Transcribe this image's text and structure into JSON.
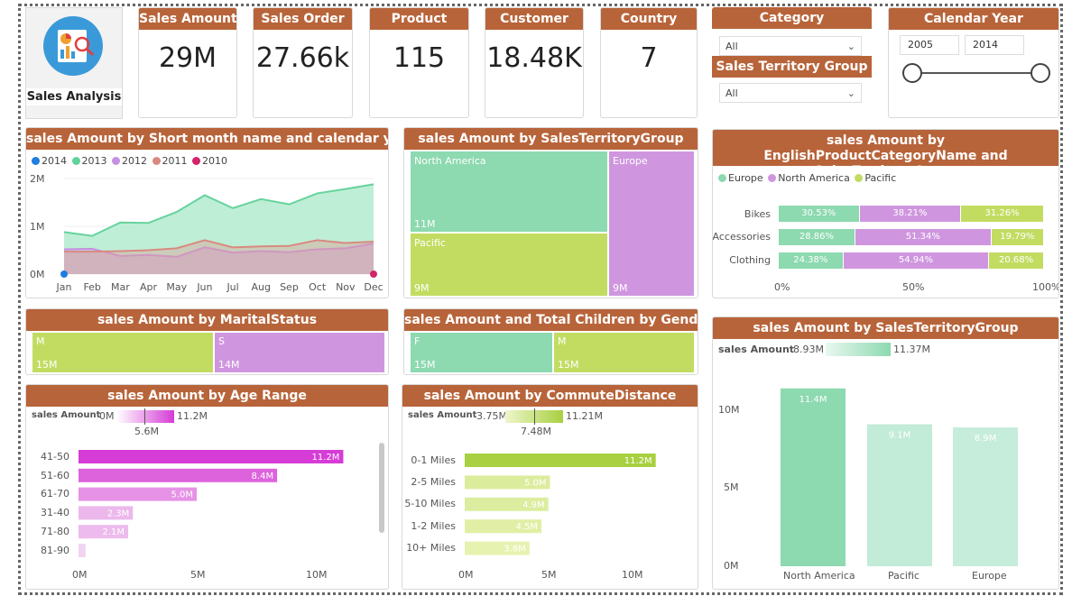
{
  "logo": {
    "title": "Sales Analysis"
  },
  "kpis": [
    {
      "title": "Sales Amount",
      "value": "29M"
    },
    {
      "title": "Sales Order",
      "value": "27.66k"
    },
    {
      "title": "Product",
      "value": "115"
    },
    {
      "title": "Customer",
      "value": "18.48K"
    },
    {
      "title": "Country",
      "value": "7"
    }
  ],
  "filters": {
    "category": {
      "title": "Category",
      "value": "All"
    },
    "territory": {
      "title": "Sales Territory Group",
      "value": "All"
    },
    "calendar": {
      "title": "Calendar Year",
      "from": "2005",
      "to": "2014"
    }
  },
  "colors": {
    "header": "#b8643a",
    "green": "#8dd9b0",
    "purple": "#cf96df",
    "lime": "#c2dc62",
    "magenta": "#d63cd6"
  },
  "chart_data": [
    {
      "type": "area",
      "title": "sales Amount by Short month name and calendar year",
      "legend": [
        "2014",
        "2013",
        "2012",
        "2011",
        "2010"
      ],
      "legend_colors": [
        "#1f7de0",
        "#5fd39a",
        "#c690e0",
        "#d98a80",
        "#d2266a"
      ],
      "x": [
        "Jan",
        "Feb",
        "Mar",
        "Apr",
        "May",
        "Jun",
        "Jul",
        "Aug",
        "Sep",
        "Oct",
        "Nov",
        "Dec"
      ],
      "yticks": [
        "2M",
        "1M",
        "0M"
      ],
      "ylim": [
        0,
        2000000
      ],
      "series": [
        {
          "name": "2013",
          "values": [
            880000,
            800000,
            1080000,
            1070000,
            1300000,
            1650000,
            1380000,
            1570000,
            1460000,
            1690000,
            1780000,
            1880000
          ]
        },
        {
          "name": "2012",
          "values": [
            520000,
            530000,
            380000,
            400000,
            360000,
            560000,
            450000,
            480000,
            460000,
            520000,
            540000,
            640000
          ]
        },
        {
          "name": "2011",
          "values": [
            470000,
            470000,
            480000,
            500000,
            540000,
            710000,
            560000,
            580000,
            590000,
            710000,
            650000,
            680000
          ]
        },
        {
          "name": "2014",
          "values": [
            20000
          ]
        },
        {
          "name": "2010",
          "values": [
            0,
            0,
            0,
            0,
            0,
            0,
            0,
            0,
            0,
            0,
            0,
            20000
          ]
        }
      ]
    },
    {
      "type": "treemap",
      "title": "sales Amount by SalesTerritoryGroup",
      "items": [
        {
          "name": "North America",
          "label": "11M",
          "value": 11.37
        },
        {
          "name": "Europe",
          "label": "9M",
          "value": 8.93
        },
        {
          "name": "Pacific",
          "label": "9M",
          "value": 9.1
        }
      ]
    },
    {
      "type": "bar",
      "title": "sales Amount by EnglishProductCategoryName and SalesTerritoryGroup",
      "legend": [
        "Europe",
        "North America",
        "Pacific"
      ],
      "categories": [
        "Bikes",
        "Accessories",
        "Clothing"
      ],
      "series": [
        {
          "name": "Europe",
          "values": [
            30.53,
            28.86,
            24.38
          ],
          "labels": [
            "30.53%",
            "28.86%",
            "24.38%"
          ]
        },
        {
          "name": "North America",
          "values": [
            38.21,
            51.34,
            54.94
          ],
          "labels": [
            "38.21%",
            "51.34%",
            "54.94%"
          ]
        },
        {
          "name": "Pacific",
          "values": [
            31.26,
            19.79,
            20.68
          ],
          "labels": [
            "31.26%",
            "19.79%",
            "20.68%"
          ]
        }
      ],
      "xticks": [
        "0%",
        "50%",
        "100%"
      ]
    },
    {
      "type": "treemap",
      "title": "sales Amount by MaritalStatus",
      "items": [
        {
          "name": "M",
          "label": "15M",
          "value": 15
        },
        {
          "name": "S",
          "label": "14M",
          "value": 14
        }
      ]
    },
    {
      "type": "treemap",
      "title": "sales Amount and Total Children by Gender",
      "items": [
        {
          "name": "F",
          "label": "15M",
          "value": 15
        },
        {
          "name": "M",
          "label": "15M",
          "value": 15
        }
      ]
    },
    {
      "type": "bar",
      "title": "sales Amount by Age Range",
      "scale_label": "sales Amount",
      "scale_min": "0M",
      "scale_mid": "5.6M",
      "scale_max": "11.2M",
      "categories": [
        "41-50",
        "51-60",
        "61-70",
        "31-40",
        "71-80",
        "81-90"
      ],
      "values": [
        11.2,
        8.4,
        5.0,
        2.3,
        2.1,
        0.3
      ],
      "labels": [
        "11.2M",
        "8.4M",
        "5.0M",
        "2.3M",
        "2.1M",
        ""
      ],
      "xticks": [
        "0M",
        "5M",
        "10M"
      ],
      "xlim": [
        0,
        13
      ]
    },
    {
      "type": "bar",
      "title": "sales Amount by CommuteDistance",
      "scale_label": "sales Amount",
      "scale_min": "3.75M",
      "scale_mid": "7.48M",
      "scale_max": "11.21M",
      "categories": [
        "0-1 Miles",
        "2-5 Miles",
        "5-10 Miles",
        "1-2 Miles",
        "10+ Miles"
      ],
      "values": [
        11.2,
        5.0,
        4.9,
        4.5,
        3.8
      ],
      "labels": [
        "11.2M",
        "5.0M",
        "4.9M",
        "4.5M",
        "3.8M"
      ],
      "xticks": [
        "0M",
        "5M",
        "10M"
      ],
      "xlim": [
        0,
        12.5
      ]
    },
    {
      "type": "bar",
      "title": "sales Amount by SalesTerritoryGroup",
      "scale_label": "sales Amount",
      "scale_min": "8.93M",
      "scale_max": "11.37M",
      "categories": [
        "North America",
        "Pacific",
        "Europe"
      ],
      "values": [
        11.4,
        9.1,
        8.9
      ],
      "labels": [
        "11.4M",
        "9.1M",
        "8.9M"
      ],
      "yticks": [
        "10M",
        "5M",
        "0M"
      ],
      "ylim": [
        0,
        12
      ]
    }
  ]
}
